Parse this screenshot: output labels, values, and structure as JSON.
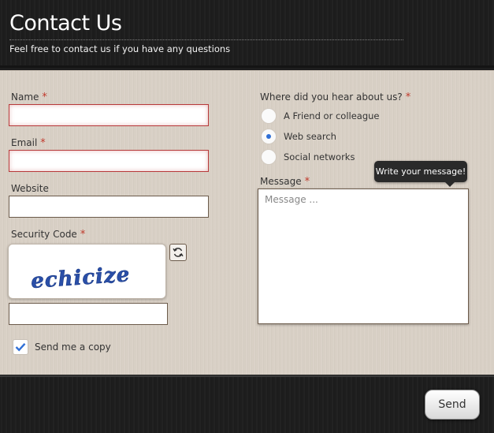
{
  "header": {
    "title": "Contact Us",
    "subtitle": "Feel free to contact us if you have any questions"
  },
  "form": {
    "name": {
      "label": "Name",
      "required_mark": "*",
      "value": ""
    },
    "email": {
      "label": "Email",
      "required_mark": "*",
      "value": ""
    },
    "website": {
      "label": "Website",
      "value": ""
    },
    "security": {
      "label": "Security Code",
      "required_mark": "*",
      "captcha_text": "echicize",
      "value": ""
    },
    "copy": {
      "label": "Send me a copy",
      "checked": true
    },
    "source": {
      "label": "Where did you hear about us?",
      "required_mark": "*",
      "options": [
        "A Friend or colleague",
        "Web search",
        "Social networks"
      ],
      "selected": "Web search"
    },
    "message": {
      "label": "Message",
      "required_mark": "*",
      "placeholder": "Message ...",
      "tooltip": "Write your message!"
    },
    "send_label": "Send"
  },
  "icons": {
    "refresh": "refresh-icon",
    "check": "checkmark-icon"
  },
  "colors": {
    "required": "#c0392b",
    "radio_selected": "#2f6fd6",
    "checkbox_check": "#2f6fd6",
    "captcha_text": "#2a4fa8"
  }
}
